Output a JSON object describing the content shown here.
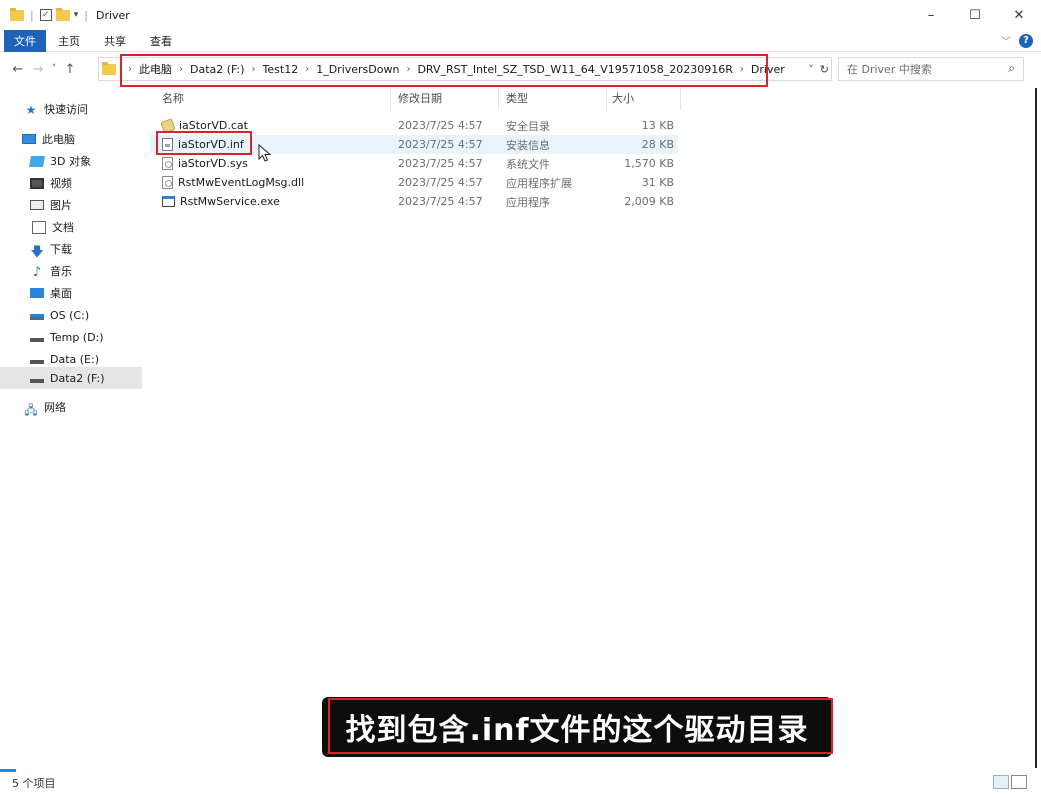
{
  "window": {
    "title": "Driver",
    "minimize": "–",
    "maximize": "☐",
    "close": "✕"
  },
  "ribbon": {
    "tabs": [
      "文件",
      "主页",
      "共享",
      "查看"
    ]
  },
  "address": {
    "breadcrumbs": [
      "此电脑",
      "Data2 (F:)",
      "Test12",
      "1_DriversDown",
      "DRV_RST_Intel_SZ_TSD_W11_64_V19571058_20230916R",
      "Driver"
    ],
    "search_placeholder": "在 Driver 中搜索"
  },
  "sidebar": {
    "items": [
      {
        "label": "快速访问",
        "icon": "star-icon"
      },
      {
        "label": "此电脑",
        "icon": "computer-icon"
      },
      {
        "label": "3D 对象",
        "icon": "3d-objects-icon"
      },
      {
        "label": "视频",
        "icon": "video-icon"
      },
      {
        "label": "图片",
        "icon": "pictures-icon"
      },
      {
        "label": "文档",
        "icon": "documents-icon"
      },
      {
        "label": "下载",
        "icon": "download-icon"
      },
      {
        "label": "音乐",
        "icon": "music-icon"
      },
      {
        "label": "桌面",
        "icon": "desktop-icon"
      },
      {
        "label": "OS (C:)",
        "icon": "os-drive-icon"
      },
      {
        "label": "Temp (D:)",
        "icon": "drive-icon"
      },
      {
        "label": "Data (E:)",
        "icon": "drive-icon"
      },
      {
        "label": "Data2 (F:)",
        "icon": "drive-icon"
      },
      {
        "label": "网络",
        "icon": "network-icon"
      }
    ]
  },
  "filelist": {
    "columns": {
      "name": "名称",
      "date": "修改日期",
      "type": "类型",
      "size": "大小"
    },
    "files": [
      {
        "name": "iaStorVD.cat",
        "date": "2023/7/25 4:57",
        "type": "安全目录",
        "size": "13 KB"
      },
      {
        "name": "iaStorVD.inf",
        "date": "2023/7/25 4:57",
        "type": "安装信息",
        "size": "28 KB"
      },
      {
        "name": "iaStorVD.sys",
        "date": "2023/7/25 4:57",
        "type": "系统文件",
        "size": "1,570 KB"
      },
      {
        "name": "RstMwEventLogMsg.dll",
        "date": "2023/7/25 4:57",
        "type": "应用程序扩展",
        "size": "31 KB"
      },
      {
        "name": "RstMwService.exe",
        "date": "2023/7/25 4:57",
        "type": "应用程序",
        "size": "2,009 KB"
      }
    ]
  },
  "subtitle": "找到包含.inf文件的这个驱动目录",
  "status": {
    "item_count": "5 个项目"
  },
  "colors": {
    "accent": "#1f63b8",
    "highlight": "#d9232d"
  }
}
